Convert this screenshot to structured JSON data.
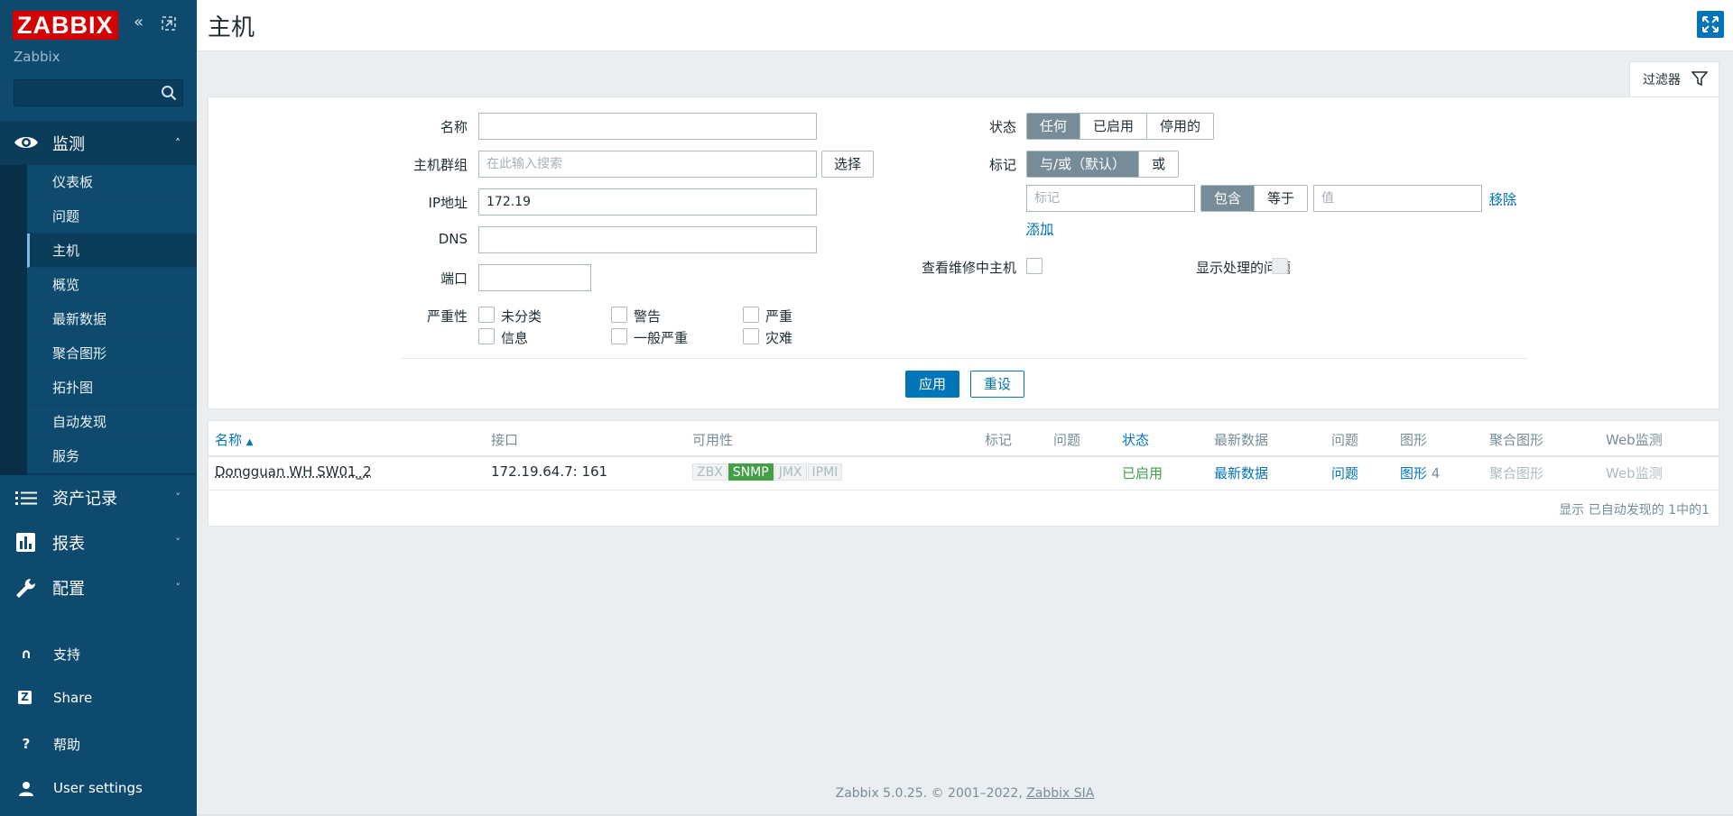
{
  "sidebar": {
    "logo": "ZABBIX",
    "server_name": "Zabbix",
    "search_placeholder": "",
    "monitoring": "监测",
    "sub_items": [
      "仪表板",
      "问题",
      "主机",
      "概览",
      "最新数据",
      "聚合图形",
      "拓扑图",
      "自动发现",
      "服务"
    ],
    "inventory": "资产记录",
    "reports": "报表",
    "configuration": "配置",
    "support": "支持",
    "share": "Share",
    "help": "帮助",
    "user_settings": "User settings"
  },
  "header": {
    "title": "主机"
  },
  "filter": {
    "tab_label": "过滤器",
    "name_label": "名称",
    "name_value": "",
    "hostgroup_label": "主机群组",
    "hostgroup_placeholder": "在此输入搜索",
    "select_button": "选择",
    "ip_label": "IP地址",
    "ip_value": "172.19",
    "dns_label": "DNS",
    "dns_value": "",
    "port_label": "端口",
    "port_value": "",
    "severity_label": "严重性",
    "severities": [
      "未分类",
      "警告",
      "严重",
      "信息",
      "一般严重",
      "灾难"
    ],
    "status_label": "状态",
    "status_options": [
      "任何",
      "已启用",
      "停用的"
    ],
    "tags_label": "标记",
    "tag_eval_options": [
      "与/或（默认）",
      "或"
    ],
    "tag_placeholder": "标记",
    "tag_op_options": [
      "包含",
      "等于"
    ],
    "value_placeholder": "值",
    "remove_link": "移除",
    "add_link": "添加",
    "maintenance_label": "查看维修中主机",
    "suppressed_label": "显示处理的问题",
    "apply_button": "应用",
    "reset_button": "重设"
  },
  "table": {
    "headers": [
      "名称",
      "接口",
      "可用性",
      "标记",
      "问题",
      "状态",
      "最新数据",
      "问题",
      "图形",
      "聚合图形",
      "Web监测"
    ],
    "row": {
      "name": "Dongguan WH SW01_2",
      "interface": "172.19.64.7: 161",
      "availability": [
        "ZBX",
        "SNMP",
        "JMX",
        "IPMI"
      ],
      "status": "已启用",
      "latest": "最新数据",
      "problems": "问题",
      "graphs": "图形",
      "graphs_count": "4",
      "screens": "聚合图形",
      "web": "Web监测"
    },
    "pager": "显示 已自动发现的 1中的1"
  },
  "footer": {
    "text": "Zabbix 5.0.25. © 2001–2022,",
    "link": "Zabbix SIA"
  },
  "colors": {
    "sidebar": "#0e4a6e",
    "accent": "#0275b8",
    "logo": "#d40000",
    "ok": "#429e47"
  }
}
